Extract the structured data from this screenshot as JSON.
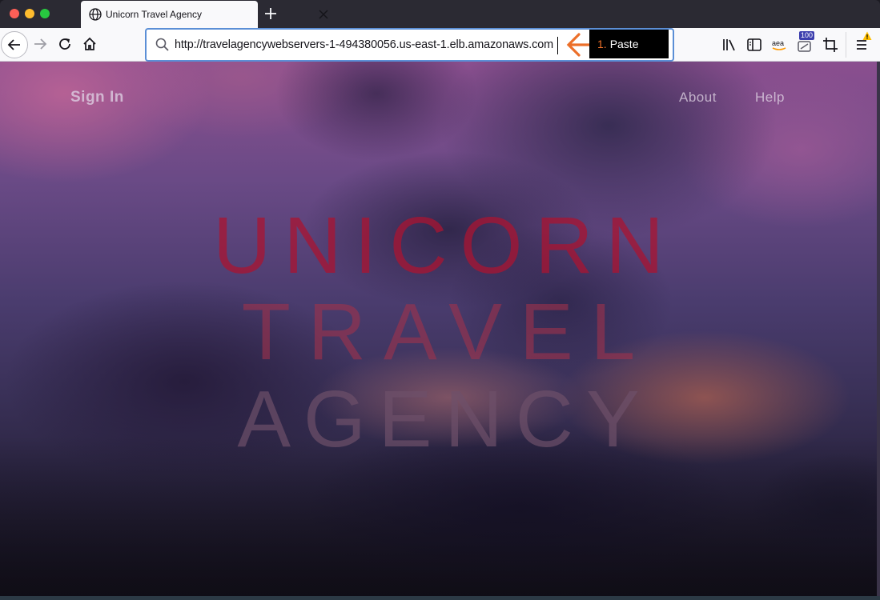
{
  "browser": {
    "tab": {
      "title": "Unicorn Travel Agency"
    },
    "url": "http://travelagencywebservers-1-494380056.us-east-1.elb.amazonaws.com",
    "annotation": {
      "number": "1.",
      "label": "Paste",
      "color": "#ec6f29"
    },
    "extension_badge": "100"
  },
  "page": {
    "nav": {
      "sign_in": "Sign In",
      "about": "About",
      "help": "Help"
    },
    "hero": {
      "line1": "UNICORN",
      "line2": "TRAVEL",
      "line3": "AGENCY"
    }
  }
}
